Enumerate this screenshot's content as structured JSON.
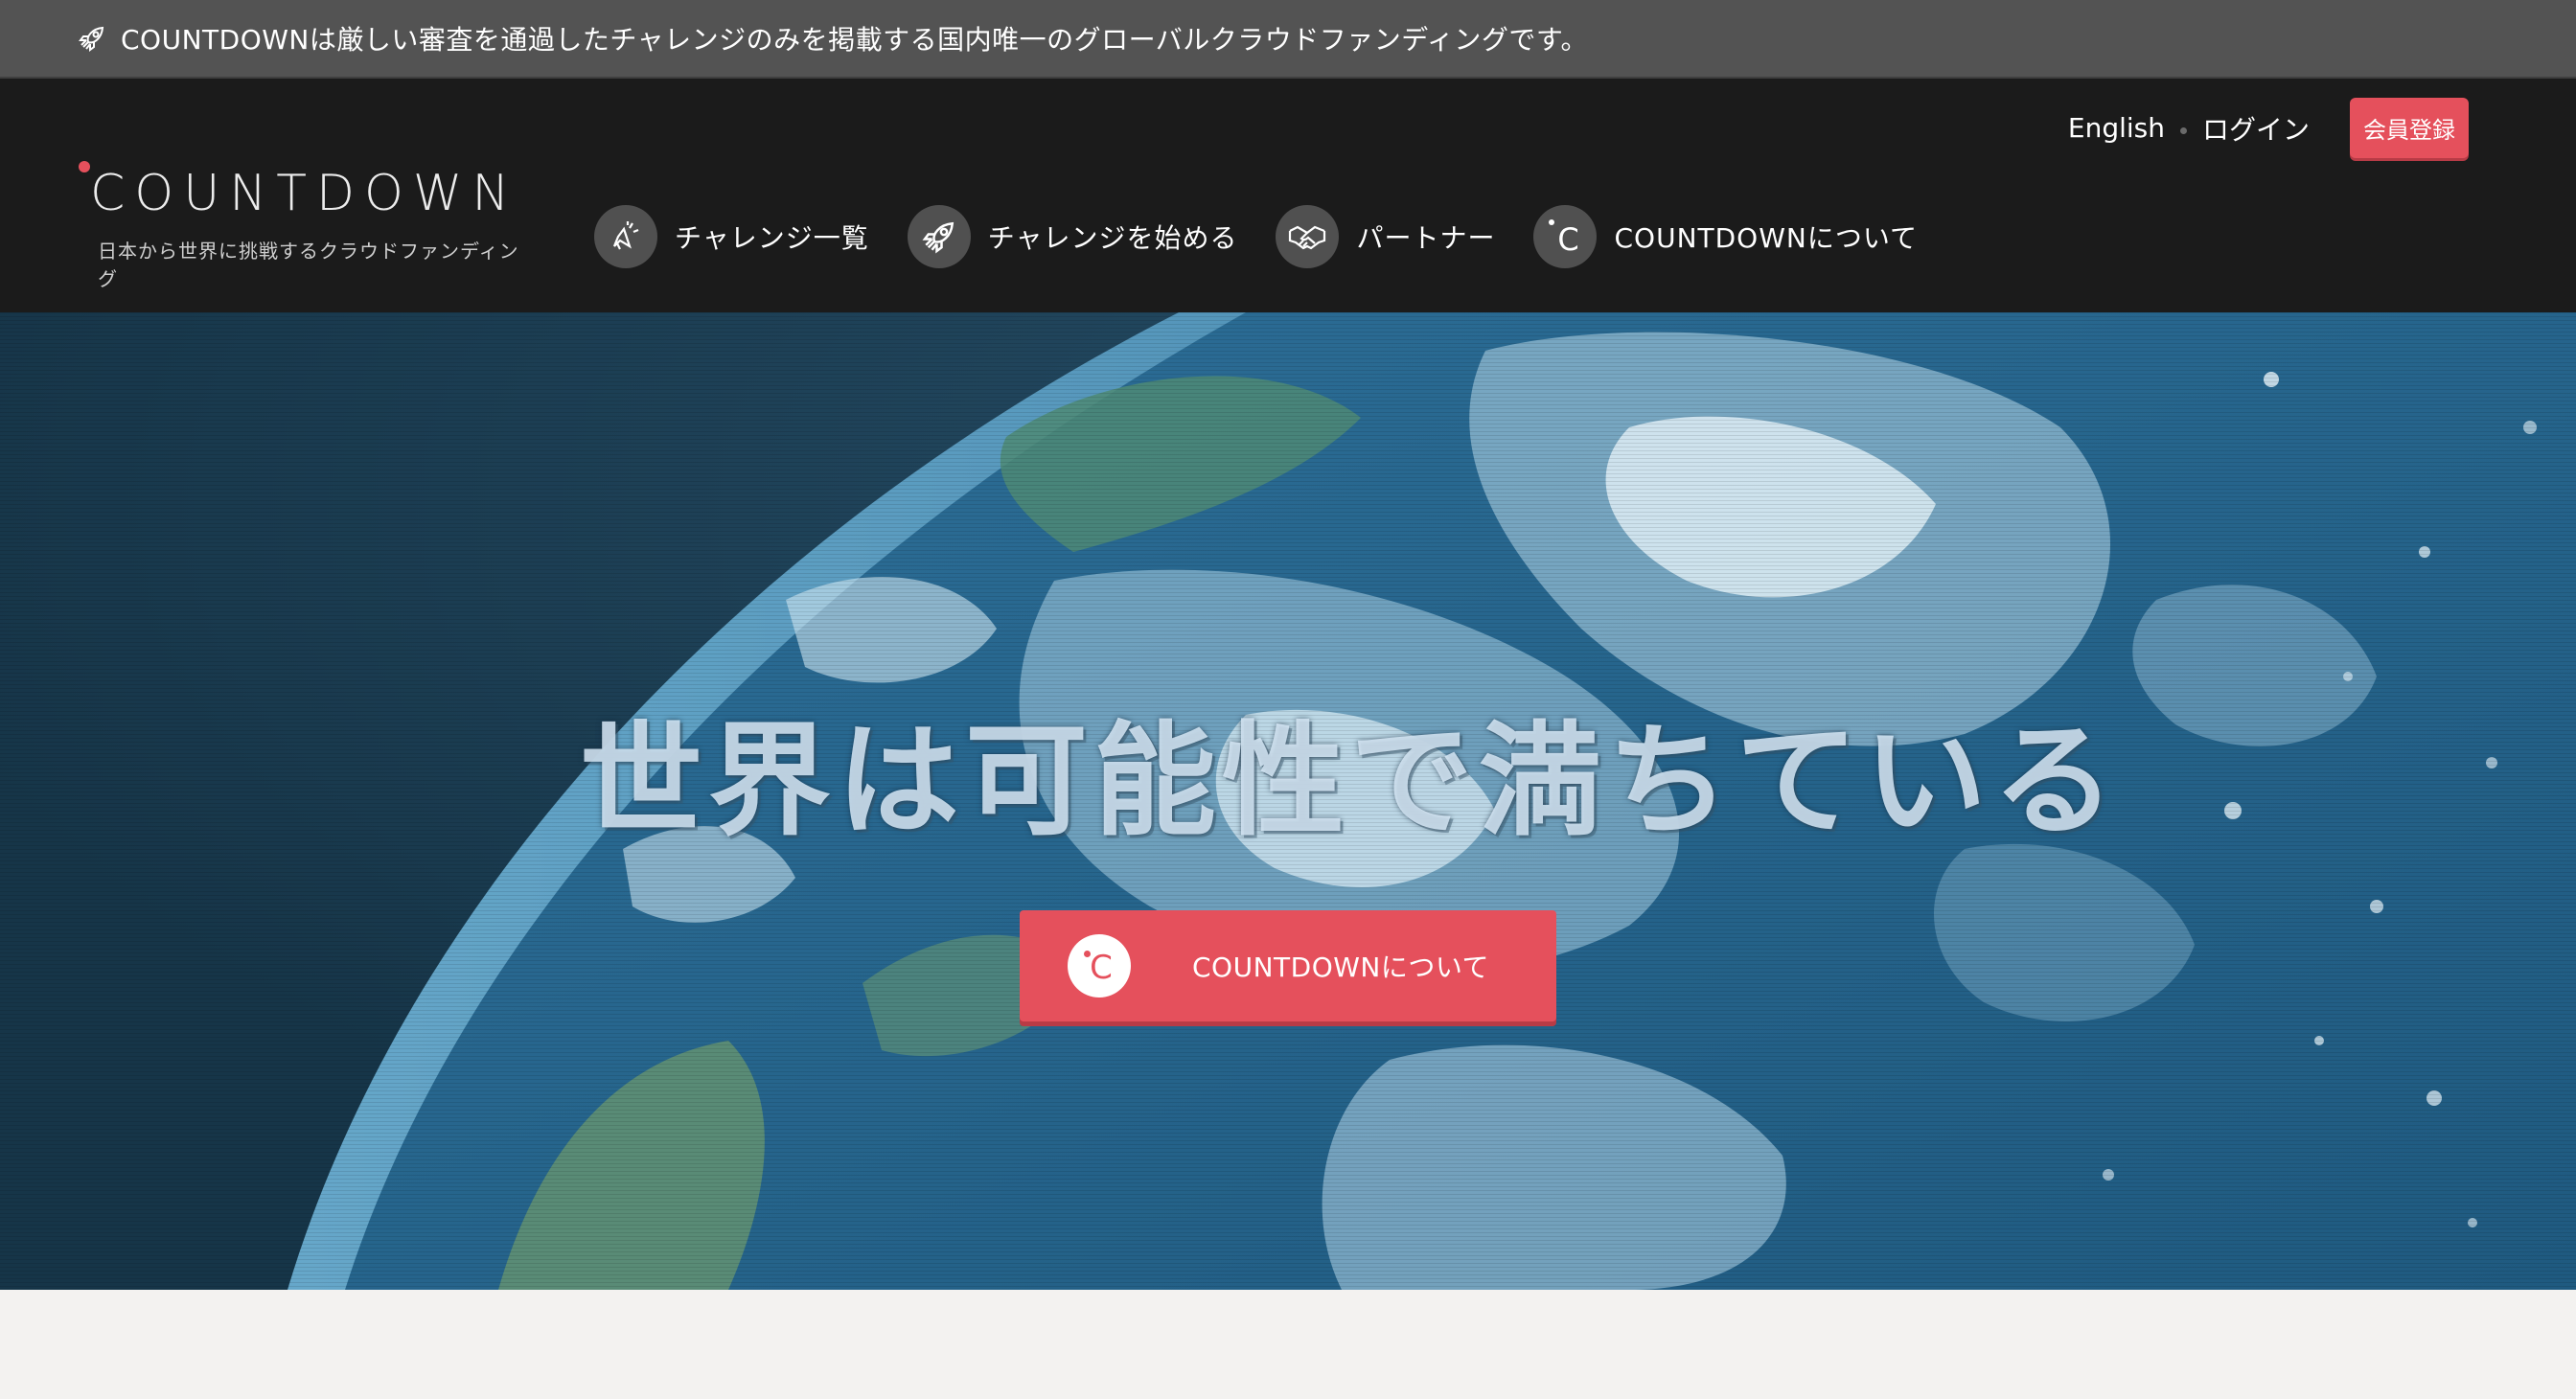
{
  "banner": {
    "icon": "rocket-icon",
    "text": "COUNTDOWNは厳しい審査を通過したチャレンジのみを掲載する国内唯一のグローバルクラウドファンディングです。"
  },
  "header": {
    "logo": {
      "wordmark": "COUNTDOWN",
      "tagline": "日本から世界に挑戦するクラウドファンディング"
    },
    "nav": [
      {
        "label": "チャレンジ一覧",
        "icon": "megaphone-icon"
      },
      {
        "label": "チャレンジを始める",
        "icon": "rocket-icon"
      },
      {
        "label": "パートナー",
        "icon": "handshake-icon"
      },
      {
        "label": "COUNTDOWNについて",
        "icon": "countdown-logo-icon"
      }
    ],
    "top_links": {
      "language": "English",
      "login": "ログイン",
      "register": "会員登録"
    }
  },
  "hero": {
    "title": "世界は可能性で満ちている",
    "button_label": "COUNTDOWNについて",
    "button_icon": "countdown-logo-icon"
  },
  "colors": {
    "accent": "#e5505c",
    "header_bg": "#1b1b1b",
    "banner_bg": "#535353",
    "page_bg": "#f3f2f0"
  }
}
